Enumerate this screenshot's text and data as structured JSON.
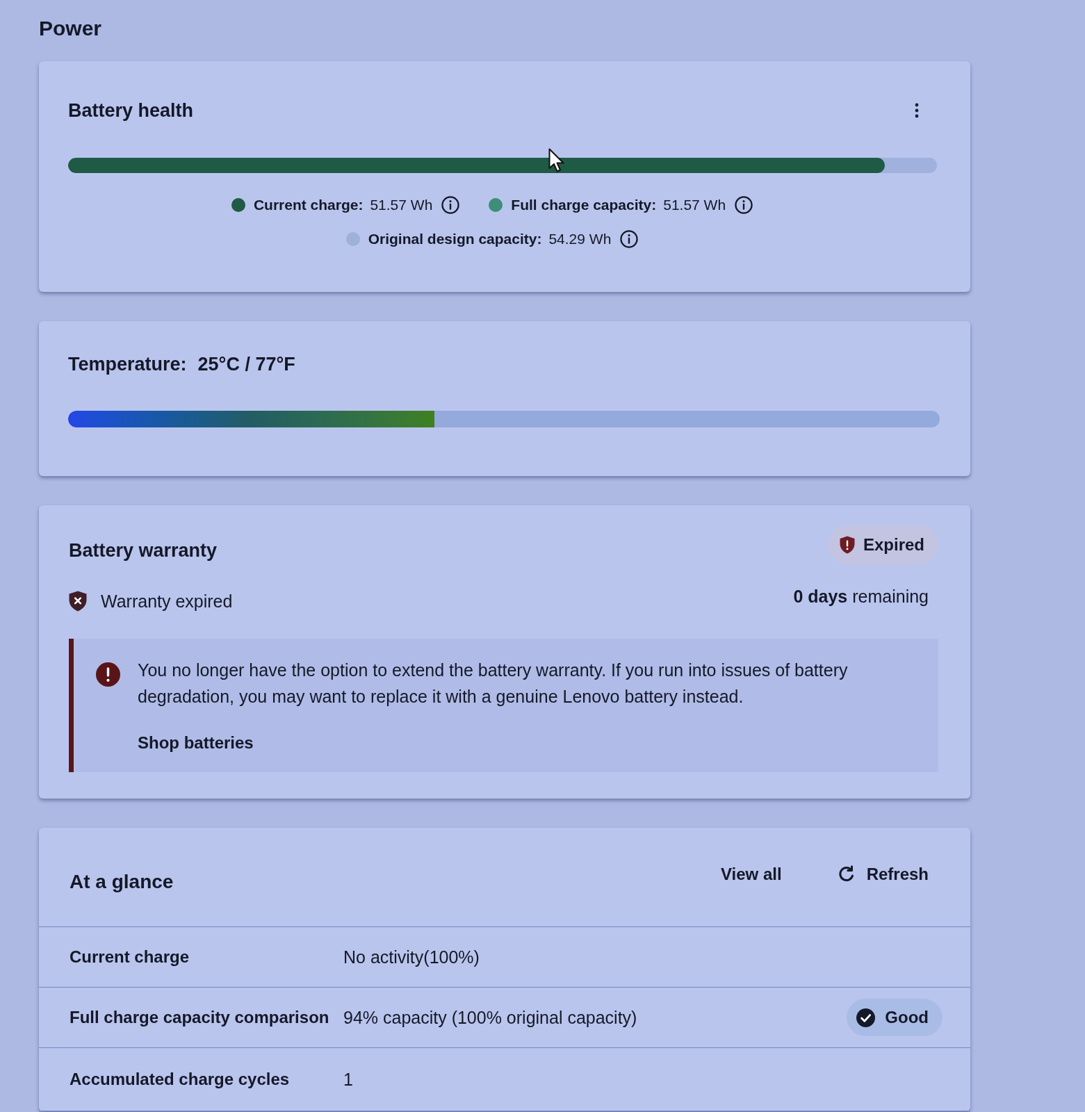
{
  "page_title": "Power",
  "battery_health": {
    "title": "Battery health",
    "bar": {
      "level": 0.94
    },
    "legend": [
      {
        "label": "Current charge:",
        "value": "51.57 Wh",
        "color": "#1f5a44"
      },
      {
        "label": "Full charge capacity:",
        "value": "51.57 Wh",
        "color": "#3d8f78"
      },
      {
        "label": "Original design capacity:",
        "value": "54.29 Wh",
        "color": "#9fb0da"
      }
    ]
  },
  "temperature": {
    "label": "Temperature:",
    "value": "25°C / 77°F",
    "bar": {
      "level": 0.42
    }
  },
  "battery_warranty": {
    "title": "Battery warranty",
    "badge": "Expired",
    "status": "Warranty expired",
    "remaining": "**0 days** remaining",
    "alert": {
      "message": "You no longer have the option to extend the battery warranty. If you run into issues of battery degradation, you may want to replace it with a genuine Lenovo battery instead.",
      "link": "Shop batteries"
    }
  },
  "at_a_glance": {
    "title": "At a glance",
    "actions": [
      {
        "kind": "link",
        "label": "View all"
      },
      {
        "kind": "refresh",
        "label": "Refresh"
      }
    ],
    "rows": [
      {
        "label": "Current charge",
        "value": "No activity(100%)"
      },
      {
        "label": "Full charge capacity comparison",
        "value": "94% capacity (100% original capacity)",
        "badge": "Good"
      },
      {
        "label": "Accumulated charge cycles",
        "value": "1"
      }
    ]
  }
}
